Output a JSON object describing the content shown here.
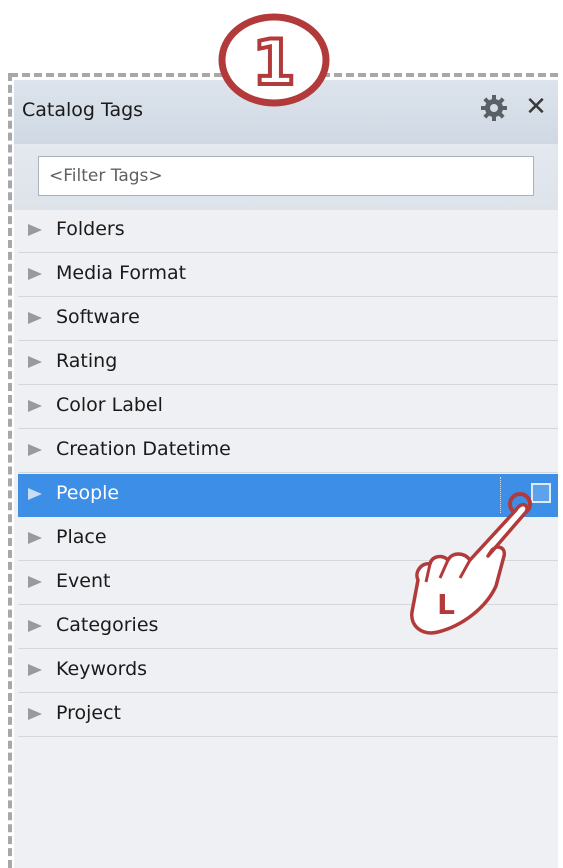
{
  "panel": {
    "title": "Catalog Tags",
    "filter_placeholder": "<Filter Tags>"
  },
  "tags": [
    {
      "label": "Folders"
    },
    {
      "label": "Media Format"
    },
    {
      "label": "Software"
    },
    {
      "label": "Rating"
    },
    {
      "label": "Color Label"
    },
    {
      "label": "Creation Datetime"
    },
    {
      "label": "People",
      "selected": true
    },
    {
      "label": "Place"
    },
    {
      "label": "Event"
    },
    {
      "label": "Categories"
    },
    {
      "label": "Keywords"
    },
    {
      "label": "Project"
    }
  ],
  "annotation": {
    "step_number": "1",
    "click_hint": "L",
    "accent_color": "#b33a3a"
  },
  "icons": {
    "settings": "gear-icon",
    "close": "close-icon",
    "expand": "triangle-right-icon"
  },
  "colors": {
    "selection": "#3d8ee6",
    "header": "#d4dce6"
  }
}
